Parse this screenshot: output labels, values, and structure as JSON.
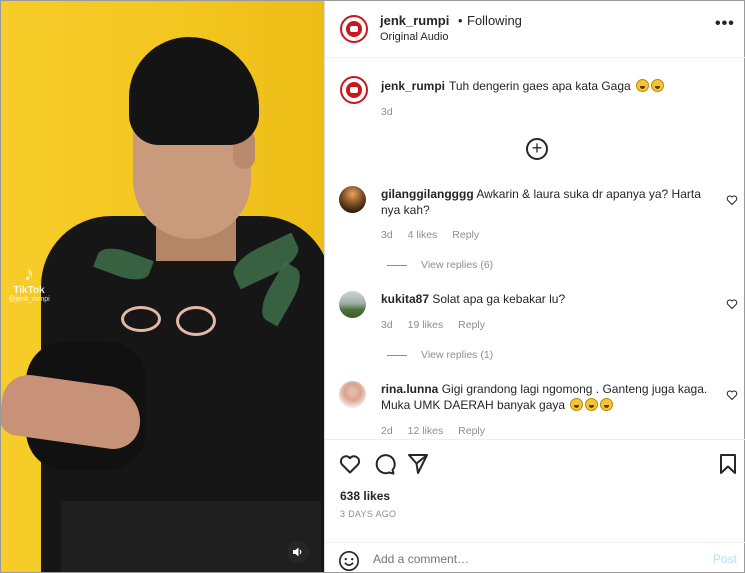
{
  "video": {
    "watermark_brand": "TikTok",
    "watermark_handle": "@jenk_rumpi",
    "audio_icon": "speaker-icon"
  },
  "header": {
    "username": "jenk_rumpi",
    "separator": "•",
    "follow_status": "Following",
    "audio_label": "Original Audio",
    "more_icon": "•••"
  },
  "caption": {
    "username": "jenk_rumpi",
    "text": "Tuh dengerin gaes apa kata Gaga",
    "emoji_count": 2,
    "time": "3d"
  },
  "load_more": "+",
  "comments": [
    {
      "username": "gilanggilangggg",
      "text": "Awkarin & laura suka dr apanya ya? Harta nya kah?",
      "time": "3d",
      "likes": "4 likes",
      "reply": "Reply",
      "view_replies": "View replies (6)"
    },
    {
      "username": "kukita87",
      "text": "Solat apa ga kebakar lu?",
      "time": "3d",
      "likes": "19 likes",
      "reply": "Reply",
      "view_replies": "View replies (1)"
    },
    {
      "username": "rina.lunna",
      "text": "Gigi grandong lagi ngomong . Ganteng juga kaga. Muka UMK DAERAH banyak gaya",
      "time": "2d",
      "likes": "12 likes",
      "reply": "Reply"
    }
  ],
  "actions": {
    "likes": "638 likes",
    "date": "3 DAYS AGO"
  },
  "add_comment": {
    "placeholder": "Add a comment…",
    "post_label": "Post"
  },
  "colors": {
    "video_bg": "#f2c31f",
    "brand_red": "#c8181e",
    "link_blue_disabled": "#b2dffc",
    "meta_gray": "#8e8e8e"
  }
}
